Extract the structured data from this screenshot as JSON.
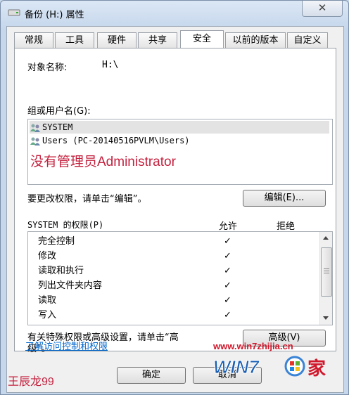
{
  "window": {
    "title": "备份 (H:) 属性",
    "close_symbol": "✕"
  },
  "tabs": [
    {
      "label": "常规"
    },
    {
      "label": "工具"
    },
    {
      "label": "硬件"
    },
    {
      "label": "共享"
    },
    {
      "label": "安全",
      "active": true
    },
    {
      "label": "以前的版本"
    },
    {
      "label": "自定义"
    }
  ],
  "security": {
    "object_name_label": "对象名称:",
    "object_name_value": "H:\\",
    "groups_label": "组或用户名(G):",
    "users": [
      "SYSTEM",
      "Users (PC-20140516PVLM\\Users)"
    ],
    "annotation": "没有管理员Administrator",
    "edit_hint": "要更改权限，请单击“编辑”。",
    "edit_button": "编辑(E)...",
    "permissions_label": "SYSTEM 的权限(P)",
    "allow_header": "允许",
    "deny_header": "拒绝",
    "permissions": [
      {
        "name": "完全控制",
        "allow": "✓"
      },
      {
        "name": "修改",
        "allow": "✓"
      },
      {
        "name": "读取和执行",
        "allow": "✓"
      },
      {
        "name": "列出文件夹内容",
        "allow": "✓"
      },
      {
        "name": "读取",
        "allow": "✓"
      },
      {
        "name": "写入",
        "allow": "✓"
      }
    ],
    "advanced_hint_line1": "有关特殊权限或高级设置，请单击“高",
    "advanced_hint_line2": "级”。",
    "advanced_button": "高级(V)",
    "link": "了解访问控制和权限"
  },
  "footer": {
    "ok": "确定",
    "cancel": "取消"
  },
  "watermark": {
    "url": "www.win7zhijia.cn",
    "logo_text": "WIN7",
    "logo_suffix": "家",
    "author": "王辰龙99"
  },
  "colors": {
    "annotation_red": "#c4213e",
    "link_blue": "#0066cc"
  }
}
